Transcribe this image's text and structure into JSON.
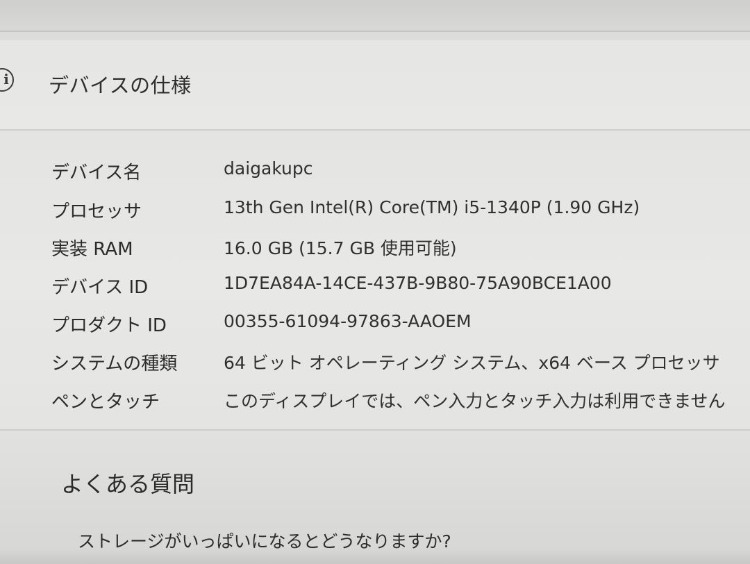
{
  "header": {
    "icon": "info-icon",
    "icon_glyph": "i",
    "title": "デバイスの仕様"
  },
  "specs": [
    {
      "label": "デバイス名",
      "value": "daigakupc"
    },
    {
      "label": "プロセッサ",
      "value": "13th Gen Intel(R) Core(TM) i5-1340P (1.90 GHz)"
    },
    {
      "label": "実装 RAM",
      "value": "16.0 GB (15.7 GB 使用可能)"
    },
    {
      "label": "デバイス ID",
      "value": "1D7EA84A-14CE-437B-9B80-75A90BCE1A00"
    },
    {
      "label": "プロダクト ID",
      "value": "00355-61094-97863-AAOEM"
    },
    {
      "label": "システムの種類",
      "value": "64 ビット オペレーティング システム、x64 ベース プロセッサ"
    },
    {
      "label": "ペンとタッチ",
      "value": "このディスプレイでは、ペン入力とタッチ入力は利用できません"
    }
  ],
  "faq": {
    "title": "よくある質問",
    "questions": [
      "ストレージがいっぱいになるとどうなりますか?"
    ]
  }
}
